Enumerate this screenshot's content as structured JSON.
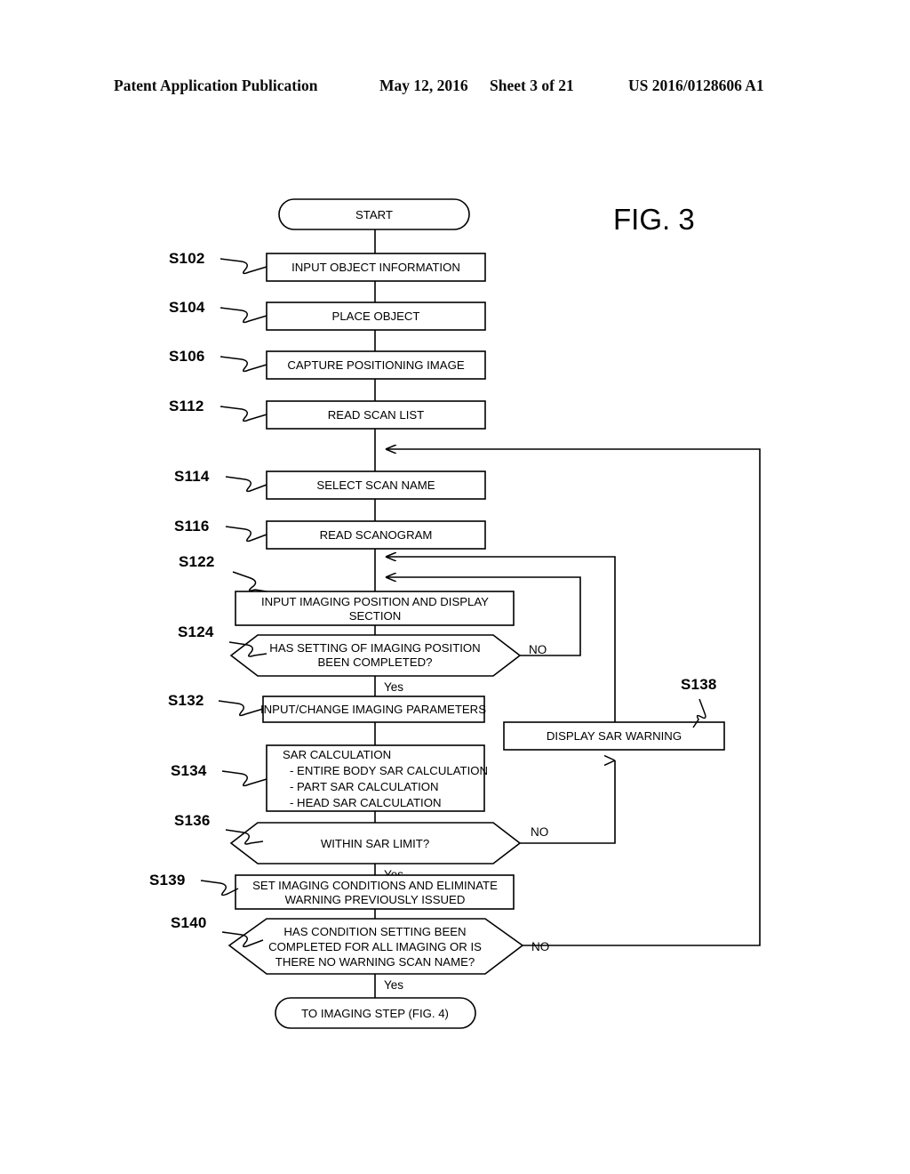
{
  "header": {
    "publication": "Patent Application Publication",
    "date": "May 12, 2016",
    "sheet": "Sheet 3 of 21",
    "number": "US 2016/0128606 A1"
  },
  "figure": {
    "label": "FIG. 3"
  },
  "flowchart": {
    "title": "FIG. 3",
    "nodes": {
      "start": {
        "text": "START",
        "shape": "terminator"
      },
      "s102": {
        "step": "S102",
        "text": "INPUT OBJECT INFORMATION",
        "shape": "process"
      },
      "s104": {
        "step": "S104",
        "text": "PLACE OBJECT",
        "shape": "process"
      },
      "s106": {
        "step": "S106",
        "text": "CAPTURE POSITIONING IMAGE",
        "shape": "process"
      },
      "s112": {
        "step": "S112",
        "text": "READ SCAN LIST",
        "shape": "process"
      },
      "s114": {
        "step": "S114",
        "text": "SELECT SCAN NAME",
        "shape": "process"
      },
      "s116": {
        "step": "S116",
        "text": "READ SCANOGRAM",
        "shape": "process"
      },
      "s122": {
        "step": "S122",
        "line1": "INPUT IMAGING POSITION AND DISPLAY",
        "line2": "SECTION",
        "shape": "process"
      },
      "s124": {
        "step": "S124",
        "line1": "HAS SETTING OF IMAGING POSITION",
        "line2": "BEEN COMPLETED?",
        "shape": "decision",
        "yes": "Yes",
        "no": "NO"
      },
      "s132": {
        "step": "S132",
        "text": "INPUT/CHANGE IMAGING PARAMETERS",
        "shape": "process"
      },
      "s134": {
        "step": "S134",
        "line1": "SAR CALCULATION",
        "line2": "- ENTIRE BODY SAR CALCULATION",
        "line3": "- PART SAR CALCULATION",
        "line4": "- HEAD SAR CALCULATION",
        "shape": "process"
      },
      "s136": {
        "step": "S136",
        "text": "WITHIN SAR LIMIT?",
        "shape": "decision",
        "yes": "Yes",
        "no": "NO"
      },
      "s138": {
        "step": "S138",
        "text": "DISPLAY SAR WARNING",
        "shape": "process"
      },
      "s139": {
        "step": "S139",
        "line1": "SET IMAGING CONDITIONS AND ELIMINATE",
        "line2": "WARNING PREVIOUSLY ISSUED",
        "shape": "process"
      },
      "s140": {
        "step": "S140",
        "line1": "HAS CONDITION SETTING BEEN",
        "line2": "COMPLETED FOR ALL IMAGING OR IS",
        "line3": "THERE NO WARNING SCAN NAME?",
        "shape": "decision",
        "yes": "Yes",
        "no": "NO"
      },
      "end": {
        "text": "TO IMAGING STEP (FIG. 4)",
        "shape": "terminator"
      }
    }
  }
}
